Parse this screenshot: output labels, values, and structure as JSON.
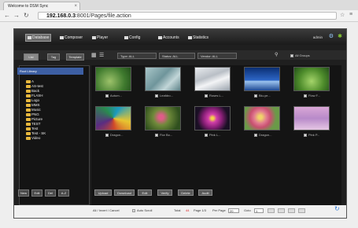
{
  "browser": {
    "tab_title": "Welcome to DSM Sync",
    "tab_close": "×",
    "url_host": "192.168.0.3",
    "url_path": ":8001/Pages/file.action"
  },
  "app": {
    "menu": [
      {
        "label": "Database"
      },
      {
        "label": "Composer"
      },
      {
        "label": "Player"
      },
      {
        "label": "Config"
      },
      {
        "label": "Accounts"
      },
      {
        "label": "Statistics"
      }
    ],
    "user": "admin"
  },
  "filters": {
    "tabs": [
      {
        "label": "List"
      },
      {
        "label": "Tag"
      },
      {
        "label": "Template"
      }
    ],
    "type_value": "Type: ALL",
    "status_value": "Status: ALL",
    "vendor_value": "Vendor: ALL",
    "groups_label": "All Groups"
  },
  "sidebar": {
    "header": "Root Library",
    "folders": [
      {
        "label": "A"
      },
      {
        "label": "AS-test"
      },
      {
        "label": "Back"
      },
      {
        "label": "FLASH"
      },
      {
        "label": "Logo"
      },
      {
        "label": "MMS"
      },
      {
        "label": "Music"
      },
      {
        "label": "PNG"
      },
      {
        "label": "Picture"
      },
      {
        "label": "TEST"
      },
      {
        "label": "Test"
      },
      {
        "label": "Test - SK"
      },
      {
        "label": "Video"
      }
    ],
    "buttons": [
      {
        "label": "New"
      },
      {
        "label": "Edit"
      },
      {
        "label": "Del"
      },
      {
        "label": "A-Z"
      }
    ]
  },
  "files": [
    {
      "name": "Autum...",
      "color": "#4c8a3e"
    },
    {
      "name": "Leafdro...",
      "color": "#7aa0a8"
    },
    {
      "name": "Roses L...",
      "color": "#c8ccd0"
    },
    {
      "name": "Blu-ye...",
      "color": "#1d4fa0"
    },
    {
      "name": "Flow F...",
      "color": "#4b8a2a"
    },
    {
      "name": "Dragon...",
      "color": "#2a6a8a"
    },
    {
      "name": "Flor Bo...",
      "color": "#6f8a3a"
    },
    {
      "name": "Pink L...",
      "color": "#a33b9a"
    },
    {
      "name": "Dragon...",
      "color": "#c86a80"
    },
    {
      "name": "Pink P...",
      "color": "#b892c8"
    }
  ],
  "actions": [
    {
      "label": "Upload"
    },
    {
      "label": "Download"
    },
    {
      "label": "Edit"
    },
    {
      "label": "Verify"
    },
    {
      "label": "Delete"
    },
    {
      "label": "Audit"
    }
  ],
  "status": {
    "select_text": "All / Invert / Cancel",
    "auto_scroll": "Auto Scroll",
    "total_label": "Total",
    "total_value": "44",
    "page_label": "Page 1/3",
    "per_page_label": "Per Page",
    "per_page_value": "20",
    "goto_label": "Goto",
    "goto_value": "1"
  }
}
